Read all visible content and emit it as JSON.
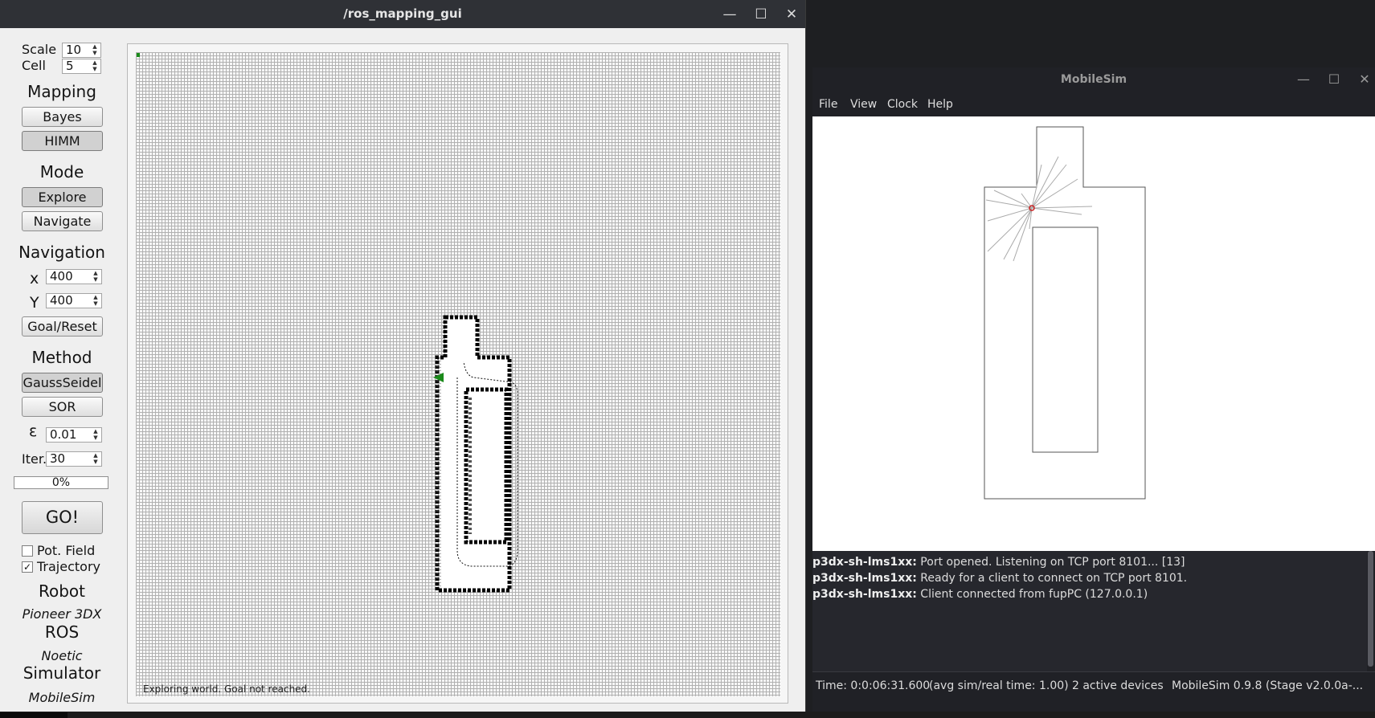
{
  "gui": {
    "title": "/ros_mapping_gui",
    "win_controls": {
      "minimize": "—",
      "maximize": "☐",
      "close": "✕"
    },
    "scale_label": "Scale",
    "scale_value": "10",
    "cell_label": "Cell",
    "cell_value": "5",
    "mapping_heading": "Mapping",
    "bayes_label": "Bayes",
    "himm_label": "HIMM",
    "mode_heading": "Mode",
    "explore_label": "Explore",
    "navigate_label": "Navigate",
    "navigation_heading": "Navigation",
    "x_label": "x",
    "x_value": "400",
    "y_label": "Y",
    "y_value": "400",
    "goal_reset_label": "Goal/Reset",
    "method_heading": "Method",
    "gauss_seidel_label": "GaussSeidel",
    "sor_label": "SOR",
    "epsilon_label": "ε",
    "epsilon_value": "0.01",
    "iter_label": "Iter.",
    "iter_value": "30",
    "progress_text": "0%",
    "progress_fraction": 0,
    "go_label": "GO!",
    "pot_field_label": "Pot. Field",
    "pot_field_checked": false,
    "trajectory_label": "Trajectory",
    "trajectory_checked": true,
    "check_mark": "✓",
    "robot_heading": "Robot",
    "robot_value": "Pioneer 3DX",
    "ros_heading": "ROS",
    "ros_value": "Noetic",
    "simulator_heading": "Simulator",
    "simulator_value": "MobileSim",
    "map_status": "Exploring world. Goal not reached."
  },
  "sim": {
    "title": "MobileSim",
    "win_controls": {
      "minimize": "—",
      "maximize": "☐",
      "close": "✕"
    },
    "menu": [
      "File",
      "View",
      "Clock",
      "Help"
    ],
    "log": [
      {
        "source": "p3dx-sh-lms1xx:",
        "message": " Port opened. Listening on TCP port 8101... [13]"
      },
      {
        "source": "p3dx-sh-lms1xx:",
        "message": " Ready for a client to connect on TCP port 8101."
      },
      {
        "source": "p3dx-sh-lms1xx:",
        "message": " Client connected from fupPC (127.0.0.1)"
      }
    ],
    "status": {
      "time": "Time: 0:0:06:31.600",
      "ratio": "(avg sim/real time: 1.00)",
      "devices": "2 active devices",
      "version": "MobileSim 0.9.8 (Stage v2.0.0a-..."
    }
  },
  "colors": {
    "titlebar": "#2f3136",
    "gui_bg": "#efefef",
    "grid_line": "#b1b1b1",
    "obstacle": "#000000",
    "robot_marker": "#1a8a1a",
    "laser_origin": "#cc2222",
    "sim_bg": "#202126"
  },
  "icons": [
    "minimize-icon",
    "maximize-icon",
    "close-icon",
    "spin-arrows-icon",
    "checkbox-icon",
    "robot-marker-icon"
  ]
}
